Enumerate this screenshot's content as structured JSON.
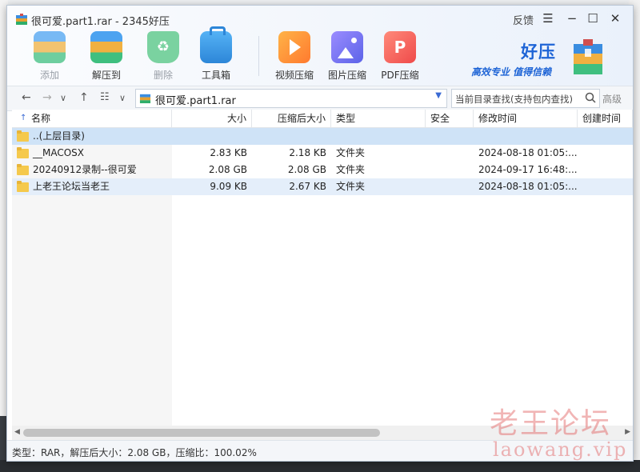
{
  "window": {
    "title": "很可爱.part1.rar - 2345好压",
    "feedback": "反馈",
    "menu_icon": "menu-icon",
    "minimize_icon": "minimize-icon",
    "maximize_icon": "maximize-icon",
    "close_icon": "close-icon"
  },
  "toolbar": {
    "items": [
      {
        "label": "添加",
        "icon": "add-archive-icon",
        "enabled": false
      },
      {
        "label": "解压到",
        "icon": "extract-to-icon",
        "enabled": true
      },
      {
        "label": "删除",
        "icon": "delete-recycle-icon",
        "enabled": false
      },
      {
        "label": "工具箱",
        "icon": "toolbox-icon",
        "enabled": true
      },
      {
        "label": "视频压缩",
        "icon": "video-compress-icon",
        "enabled": true
      },
      {
        "label": "图片压缩",
        "icon": "image-compress-icon",
        "enabled": true
      },
      {
        "label": "PDF压缩",
        "icon": "pdf-compress-icon",
        "enabled": true
      }
    ]
  },
  "brand": {
    "name": "好压",
    "slogan": "高效专业 值得信赖",
    "color": "#1e64d6"
  },
  "navbar": {
    "path": "很可爱.part1.rar",
    "search_placeholder": "当前目录查找(支持包内查找)",
    "advanced": "高级"
  },
  "table": {
    "columns": [
      "名称",
      "大小",
      "压缩后大小",
      "类型",
      "安全",
      "修改时间",
      "创建时间"
    ],
    "rows": [
      {
        "name": "..(上层目录)",
        "size": "",
        "packed": "",
        "type": "",
        "security": "",
        "modified": "",
        "created": ""
      },
      {
        "name": "__MACOSX",
        "size": "2.83 KB",
        "packed": "2.18 KB",
        "type": "文件夹",
        "security": "",
        "modified": "2024-08-18 01:05:...",
        "created": ""
      },
      {
        "name": "20240912录制--很可爱",
        "size": "2.08 GB",
        "packed": "2.08 GB",
        "type": "文件夹",
        "security": "",
        "modified": "2024-09-17 16:48:...",
        "created": ""
      },
      {
        "name": "上老王论坛当老王",
        "size": "9.09 KB",
        "packed": "2.67 KB",
        "type": "文件夹",
        "security": "",
        "modified": "2024-08-18 01:05:...",
        "created": ""
      }
    ]
  },
  "status": {
    "text": "类型：RAR，解压后大小：2.08 GB，压缩比：100.02%"
  },
  "watermark": {
    "line1": "老王论坛",
    "line2": "laowang.vip"
  }
}
